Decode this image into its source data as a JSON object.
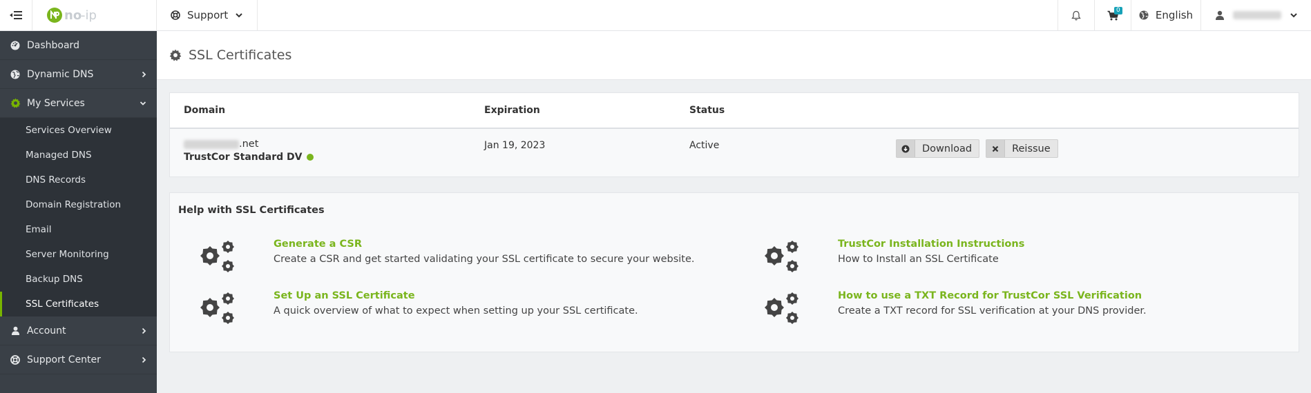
{
  "topbar": {
    "support_label": "Support",
    "cart_count": "0",
    "language": "English"
  },
  "sidebar": {
    "items": [
      {
        "label": "Dashboard",
        "icon": "dashboard-icon"
      },
      {
        "label": "Dynamic DNS",
        "icon": "globe-icon"
      },
      {
        "label": "My Services",
        "icon": "gear-icon"
      },
      {
        "label": "Account",
        "icon": "user-icon"
      },
      {
        "label": "Support Center",
        "icon": "lifebuoy-icon"
      }
    ],
    "sub_items": [
      "Services Overview",
      "Managed DNS",
      "DNS Records",
      "Domain Registration",
      "Email",
      "Server Monitoring",
      "Backup DNS",
      "SSL Certificates"
    ],
    "accent_color": "#78b500"
  },
  "page": {
    "title": "SSL Certificates"
  },
  "table": {
    "headers": {
      "domain": "Domain",
      "expiration": "Expiration",
      "status": "Status"
    },
    "row": {
      "domain_suffix": ".net",
      "certificate_type": "TrustCor Standard DV",
      "expiration": "Jan 19, 2023",
      "status": "Active",
      "download_label": "Download",
      "reissue_label": "Reissue"
    }
  },
  "help": {
    "title": "Help with SSL Certificates",
    "items": [
      {
        "title": "Generate a CSR",
        "desc": "Create a CSR and get started validating your SSL certificate to secure your website."
      },
      {
        "title": "TrustCor Installation Instructions",
        "desc": "How to Install an SSL Certificate"
      },
      {
        "title": "Set Up an SSL Certificate",
        "desc": "A quick overview of what to expect when setting up your SSL certificate."
      },
      {
        "title": "How to use a TXT Record for TrustCor SSL Verification",
        "desc": "Create a TXT record for SSL verification at your DNS provider."
      }
    ],
    "link_color": "#7ab51d"
  }
}
